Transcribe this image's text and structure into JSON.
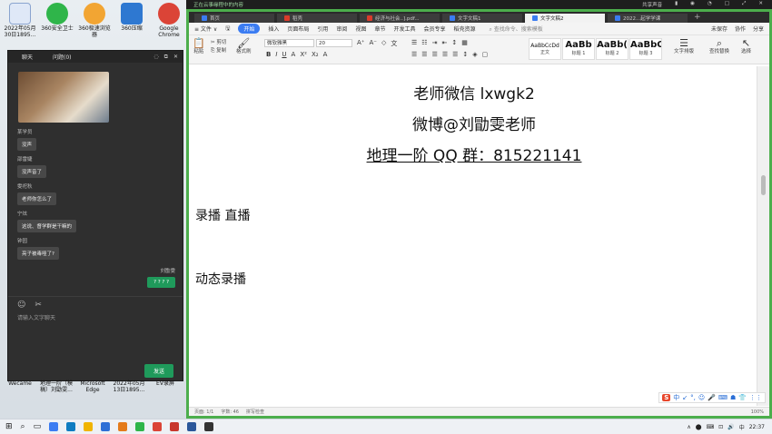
{
  "desktop": {
    "icons": [
      {
        "label": "2022年05月30日1895...",
        "icon": "document-icon",
        "color": "#dfe8f7"
      },
      {
        "label": "360安全卫士",
        "icon": "shield-plus-icon",
        "color": "#2fb54a"
      },
      {
        "label": "360极速浏览器",
        "icon": "browser-icon",
        "color": "#f2a533"
      },
      {
        "label": "360压缩",
        "icon": "archive-icon",
        "color": "#2e78d1"
      },
      {
        "label": "Google Chrome",
        "icon": "chrome-icon",
        "color": "#db4437"
      }
    ],
    "bottom_icons": [
      {
        "label": "Wecame"
      },
      {
        "label": "地理一阶（模稿）刘勖雯..."
      },
      {
        "label": "Microsoft Edge"
      },
      {
        "label": "2022年05月13日1895..."
      },
      {
        "label": "EV录屏"
      }
    ]
  },
  "screen_share_bar": {
    "text": "正在云事缘程中的内容",
    "right": [
      "共享声音",
      "▮",
      "◉",
      "◔",
      "□",
      "⤢",
      "✕"
    ]
  },
  "chat": {
    "header": {
      "tab1": "聊天",
      "tab2": "问题(0)"
    },
    "messages": [
      {
        "name": "某学员",
        "text": "没声"
      },
      {
        "name": "邵雷婕",
        "text": "没声音了"
      },
      {
        "name": "雯祀秋",
        "text": "老师你怎么了"
      },
      {
        "name": "宁炫",
        "text": "这说、督学群是干嘛的"
      },
      {
        "name": "钟园",
        "text": "亮子被毒哑了?"
      }
    ],
    "self": {
      "name": "刘勖雯",
      "text": "? ? ? ?"
    },
    "tools": [
      "☺",
      "✂"
    ],
    "input_placeholder": "请输入文字聊天",
    "send_label": "发送"
  },
  "app": {
    "tabs": [
      {
        "label": "首页",
        "icon_color": "#3b7cf2",
        "active": false
      },
      {
        "label": "稻壳",
        "icon_color": "#d93b2b",
        "active": false
      },
      {
        "label": "经济与社会..].pdf...",
        "icon_color": "#d93b2b",
        "active": false
      },
      {
        "label": "文字文稿1",
        "icon_color": "#3b7cf2",
        "active": false
      },
      {
        "label": "文字文稿2",
        "icon_color": "#3b7cf2",
        "active": true
      },
      {
        "label": "2022...起学学课",
        "icon_color": "#3b7cf2",
        "active": false
      }
    ],
    "menu": {
      "file": "≡ 文件 ∨",
      "start": "开始",
      "items": [
        "插入",
        "页面布局",
        "引用",
        "审阅",
        "视图",
        "章节",
        "开发工具",
        "会员专享",
        "稻壳资源"
      ],
      "search": "查找命令、搜索模板",
      "right": [
        "未保存",
        "协作",
        "分享"
      ]
    },
    "ribbon": {
      "paste": "粘贴",
      "cut": "剪切",
      "copy": "复制",
      "format_painter": "格式刷",
      "font_name": "微软雅黑",
      "font_size": "20",
      "styles": [
        {
          "preview": "AaBbCcDd",
          "name": "正文"
        },
        {
          "preview": "AaBb",
          "name": "标题 1"
        },
        {
          "preview": "AaBb(",
          "name": "标题 2"
        },
        {
          "preview": "AaBbC",
          "name": "标题 3"
        }
      ],
      "text_layout": "文字排版",
      "find_replace": "查找替换",
      "select": "选择"
    },
    "document": {
      "line1": "老师微信 lxwgk2",
      "line2": "微博@刘勖雯老师",
      "line3": "地理一阶 QQ 群：815221141",
      "line4": "录播 直播",
      "line5": "动态录播"
    },
    "status": {
      "page": "页面: 1/1",
      "words": "字数: 46",
      "spell": "拼写检查",
      "zoom": "100%"
    },
    "ime": [
      "S",
      "中",
      "↙",
      "°,",
      "☺",
      "🎤",
      "⌨",
      "☗",
      "👕",
      "⋮⋮"
    ]
  },
  "taskbar": {
    "time": "22:37",
    "tray": [
      "∧",
      "⬤",
      "⌨",
      "⊡",
      "🔊",
      "中"
    ]
  }
}
